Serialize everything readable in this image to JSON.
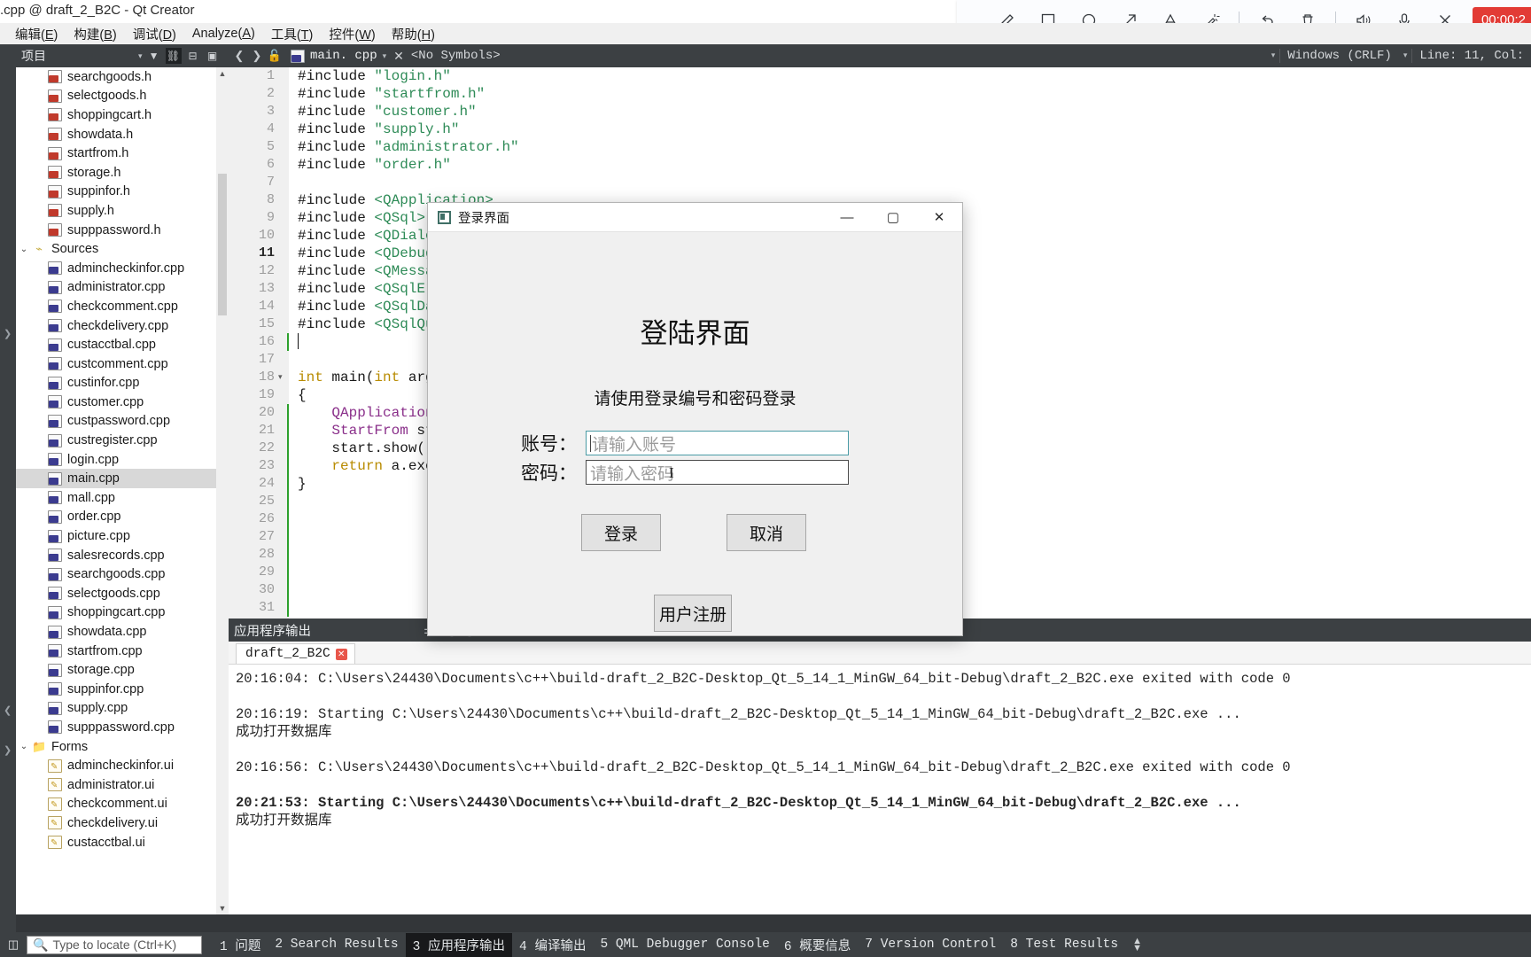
{
  "window": {
    "title": ".cpp @ draft_2_B2C - Qt Creator"
  },
  "recorder": {
    "timer": "00:00:2",
    "tools": [
      {
        "name": "pen-icon",
        "glyph": "✏"
      },
      {
        "name": "rectangle-icon",
        "glyph": "▢"
      },
      {
        "name": "ellipse-icon",
        "glyph": "◯"
      },
      {
        "name": "arrow-icon",
        "glyph": "↗"
      },
      {
        "name": "text-icon",
        "glyph": "A"
      },
      {
        "name": "magic-wand-icon",
        "glyph": "🪄"
      },
      {
        "name": "undo-icon",
        "glyph": "↺"
      },
      {
        "name": "trash-icon",
        "glyph": "🗑"
      },
      {
        "name": "speaker-icon",
        "glyph": "🔊"
      },
      {
        "name": "microphone-icon",
        "glyph": "🎤"
      },
      {
        "name": "close-icon",
        "glyph": "✕"
      }
    ]
  },
  "menubar": [
    {
      "label": "编辑",
      "key": "E"
    },
    {
      "label": "构建",
      "key": "B"
    },
    {
      "label": "调试",
      "key": "D"
    },
    {
      "label": "Analyze",
      "key": "A"
    },
    {
      "label": "工具",
      "key": "T"
    },
    {
      "label": "控件",
      "key": "W"
    },
    {
      "label": "帮助",
      "key": "H"
    }
  ],
  "sidebar": {
    "header_label": "项目",
    "tree": [
      {
        "label": "searchgoods.h",
        "type": "h",
        "indent": 2
      },
      {
        "label": "selectgoods.h",
        "type": "h",
        "indent": 2
      },
      {
        "label": "shoppingcart.h",
        "type": "h",
        "indent": 2
      },
      {
        "label": "showdata.h",
        "type": "h",
        "indent": 2
      },
      {
        "label": "startfrom.h",
        "type": "h",
        "indent": 2
      },
      {
        "label": "storage.h",
        "type": "h",
        "indent": 2
      },
      {
        "label": "suppinfor.h",
        "type": "h",
        "indent": 2
      },
      {
        "label": "supply.h",
        "type": "h",
        "indent": 2
      },
      {
        "label": "supppassword.h",
        "type": "h",
        "indent": 2
      },
      {
        "label": "Sources",
        "type": "folder-src",
        "indent": 1,
        "expanded": true
      },
      {
        "label": "admincheckinfor.cpp",
        "type": "cpp",
        "indent": 2
      },
      {
        "label": "administrator.cpp",
        "type": "cpp",
        "indent": 2
      },
      {
        "label": "checkcomment.cpp",
        "type": "cpp",
        "indent": 2
      },
      {
        "label": "checkdelivery.cpp",
        "type": "cpp",
        "indent": 2
      },
      {
        "label": "custacctbal.cpp",
        "type": "cpp",
        "indent": 2
      },
      {
        "label": "custcomment.cpp",
        "type": "cpp",
        "indent": 2
      },
      {
        "label": "custinfor.cpp",
        "type": "cpp",
        "indent": 2
      },
      {
        "label": "customer.cpp",
        "type": "cpp",
        "indent": 2
      },
      {
        "label": "custpassword.cpp",
        "type": "cpp",
        "indent": 2
      },
      {
        "label": "custregister.cpp",
        "type": "cpp",
        "indent": 2
      },
      {
        "label": "login.cpp",
        "type": "cpp",
        "indent": 2
      },
      {
        "label": "main.cpp",
        "type": "cpp",
        "indent": 2,
        "selected": true
      },
      {
        "label": "mall.cpp",
        "type": "cpp",
        "indent": 2
      },
      {
        "label": "order.cpp",
        "type": "cpp",
        "indent": 2
      },
      {
        "label": "picture.cpp",
        "type": "cpp",
        "indent": 2
      },
      {
        "label": "salesrecords.cpp",
        "type": "cpp",
        "indent": 2
      },
      {
        "label": "searchgoods.cpp",
        "type": "cpp",
        "indent": 2
      },
      {
        "label": "selectgoods.cpp",
        "type": "cpp",
        "indent": 2
      },
      {
        "label": "shoppingcart.cpp",
        "type": "cpp",
        "indent": 2
      },
      {
        "label": "showdata.cpp",
        "type": "cpp",
        "indent": 2
      },
      {
        "label": "startfrom.cpp",
        "type": "cpp",
        "indent": 2
      },
      {
        "label": "storage.cpp",
        "type": "cpp",
        "indent": 2
      },
      {
        "label": "suppinfor.cpp",
        "type": "cpp",
        "indent": 2
      },
      {
        "label": "supply.cpp",
        "type": "cpp",
        "indent": 2
      },
      {
        "label": "supppassword.cpp",
        "type": "cpp",
        "indent": 2
      },
      {
        "label": "Forms",
        "type": "folder-ui",
        "indent": 1,
        "expanded": true
      },
      {
        "label": "admincheckinfor.ui",
        "type": "ui",
        "indent": 2
      },
      {
        "label": "administrator.ui",
        "type": "ui",
        "indent": 2
      },
      {
        "label": "checkcomment.ui",
        "type": "ui",
        "indent": 2
      },
      {
        "label": "checkdelivery.ui",
        "type": "ui",
        "indent": 2
      },
      {
        "label": "custacctbal.ui",
        "type": "ui",
        "indent": 2
      }
    ]
  },
  "editor": {
    "filename": "main. cpp",
    "symbol": "<No Symbols>",
    "line_ending": "Windows (CRLF)",
    "cursor_position": "Line: 11, Col:",
    "lines": [
      {
        "n": "1",
        "text": "#include \"login.h\"",
        "pre": "#include ",
        "str": "\"login.h\""
      },
      {
        "n": "2",
        "text": "#include \"startfrom.h\"",
        "pre": "#include ",
        "str": "\"startfrom.h\""
      },
      {
        "n": "3",
        "text": "#include \"customer.h\"",
        "pre": "#include ",
        "str": "\"customer.h\""
      },
      {
        "n": "4",
        "text": "#include \"supply.h\"",
        "pre": "#include ",
        "str": "\"supply.h\""
      },
      {
        "n": "5",
        "text": "#include \"administrator.h\"",
        "pre": "#include ",
        "str": "\"administrator.h\""
      },
      {
        "n": "6",
        "text": "#include \"order.h\"",
        "pre": "#include ",
        "str": "\"order.h\""
      },
      {
        "n": "7",
        "text": "",
        "pre": "",
        "str": ""
      },
      {
        "n": "8",
        "text": "#include <QApplication>",
        "pre": "#include ",
        "str": "<QApplication>"
      },
      {
        "n": "9",
        "text": "#include <QSql>",
        "pre": "#include ",
        "str": "<QSql>"
      },
      {
        "n": "10",
        "text": "#include <QDialog>",
        "pre": "#include ",
        "str": "<QDialog>"
      },
      {
        "n": "11",
        "text": "#include <QDebug>",
        "pre": "#include ",
        "str": "<QDebug>",
        "current": true
      },
      {
        "n": "12",
        "text": "#include <QMessageBox>",
        "pre": "#include ",
        "str": "<QMessageBox>"
      },
      {
        "n": "13",
        "text": "#include <QSqlError>",
        "pre": "#include ",
        "str": "<QSqlError>"
      },
      {
        "n": "14",
        "text": "#include <QSqlDatabase>",
        "pre": "#include ",
        "str": "<QSqlDatabase>"
      },
      {
        "n": "15",
        "text": "#include <QSqlQuery>",
        "pre": "#include ",
        "str": "<QSqlQuery>"
      },
      {
        "n": "16",
        "text": "",
        "pre": "",
        "str": "",
        "caret": true
      },
      {
        "n": "17",
        "text": "",
        "pre": "",
        "str": ""
      },
      {
        "n": "18",
        "text": "int main(int argc, char *argv[])",
        "fold": true
      },
      {
        "n": "19",
        "text": "{"
      },
      {
        "n": "20",
        "text": "    QApplication a(argc, argv);"
      },
      {
        "n": "21",
        "text": "    StartFrom start;"
      },
      {
        "n": "22",
        "text": "    start.show();"
      },
      {
        "n": "23",
        "text": "    return a.exec();"
      },
      {
        "n": "24",
        "text": "}"
      },
      {
        "n": "25",
        "text": ""
      },
      {
        "n": "26",
        "text": ""
      },
      {
        "n": "27",
        "text": ""
      },
      {
        "n": "28",
        "text": ""
      },
      {
        "n": "29",
        "text": ""
      },
      {
        "n": "30",
        "text": ""
      },
      {
        "n": "31",
        "text": ""
      }
    ]
  },
  "output": {
    "header_title": "应用程序输出",
    "tab_label": "draft_2_B2C",
    "lines": [
      {
        "text": "20:16:04: C:\\Users\\24430\\Documents\\c++\\build-draft_2_B2C-Desktop_Qt_5_14_1_MinGW_64_bit-Debug\\draft_2_B2C.exe exited with code 0",
        "bold": false
      },
      {
        "text": "",
        "bold": false
      },
      {
        "text": "20:16:19: Starting C:\\Users\\24430\\Documents\\c++\\build-draft_2_B2C-Desktop_Qt_5_14_1_MinGW_64_bit-Debug\\draft_2_B2C.exe ...",
        "bold": false
      },
      {
        "text": "成功打开数据库",
        "bold": false
      },
      {
        "text": "",
        "bold": false
      },
      {
        "text": "20:16:56: C:\\Users\\24430\\Documents\\c++\\build-draft_2_B2C-Desktop_Qt_5_14_1_MinGW_64_bit-Debug\\draft_2_B2C.exe exited with code 0",
        "bold": false
      },
      {
        "text": "",
        "bold": false
      },
      {
        "text": "20:21:53: Starting C:\\Users\\24430\\Documents\\c++\\build-draft_2_B2C-Desktop_Qt_5_14_1_MinGW_64_bit-Debug\\draft_2_B2C.exe ...",
        "bold": true
      },
      {
        "text": "成功打开数据库",
        "bold": false
      }
    ]
  },
  "statusbar": {
    "search_placeholder": "Type to locate (Ctrl+K)",
    "items": [
      {
        "num": "1",
        "label": "问题",
        "active": false
      },
      {
        "num": "2",
        "label": "Search Results",
        "active": false
      },
      {
        "num": "3",
        "label": "应用程序输出",
        "active": true
      },
      {
        "num": "4",
        "label": "编译输出",
        "active": false
      },
      {
        "num": "5",
        "label": "QML Debugger Console",
        "active": false
      },
      {
        "num": "6",
        "label": "概要信息",
        "active": false
      },
      {
        "num": "7",
        "label": "Version Control",
        "active": false
      },
      {
        "num": "8",
        "label": "Test Results",
        "active": false
      }
    ]
  },
  "dialog": {
    "title": "登录界面",
    "heading": "登陆界面",
    "subtitle": "请使用登录编号和密码登录",
    "account_label": "账号：",
    "account_placeholder": "请输入账号",
    "password_label": "密码：",
    "password_placeholder": "请输入密码",
    "login_button": "登录",
    "cancel_button": "取消",
    "register_button": "用户注册",
    "minimize": "—",
    "maximize": "▢",
    "close": "✕"
  },
  "colors": {
    "accent_record": "#e23b35",
    "dark_chrome": "#3c4043",
    "dialog_bg": "#f0f0f0",
    "focus_border": "#4a9ba5",
    "string_green": "#2e8b57"
  }
}
